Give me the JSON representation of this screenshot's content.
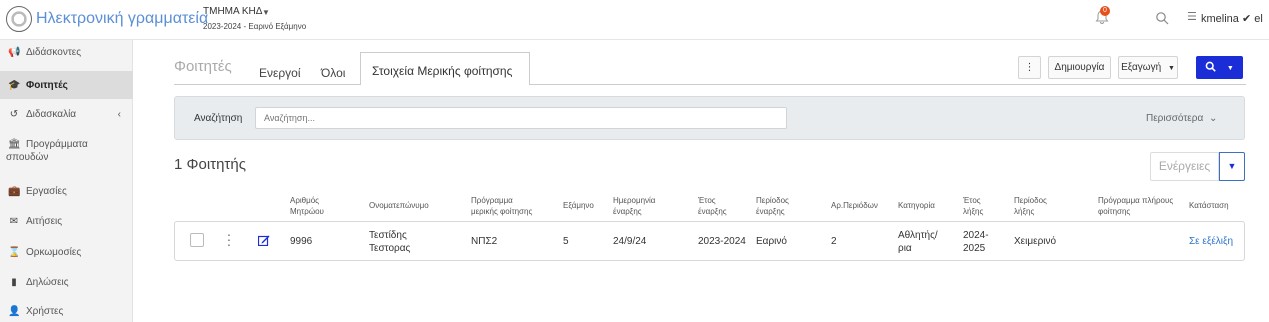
{
  "header": {
    "app_title": "Ηλεκτρονική γραμματεία",
    "department": "ΤΜΗΜΑ ΚΗΔ",
    "period": "2023-2024 - Εαρινό Εξάμηνο",
    "notification_count": "0",
    "user": "kmelina ✔ el"
  },
  "sidebar": {
    "items": [
      {
        "label": "Διδάσκοντες",
        "icon": "megaphone-icon"
      },
      {
        "label": "Φοιτητές",
        "icon": "graduation-cap-icon"
      },
      {
        "label": "Διδασκαλία",
        "icon": "undo-icon"
      },
      {
        "label": "Προγράμματα σπουδών",
        "icon": "institution-icon"
      },
      {
        "label": "Εργασίες",
        "icon": "briefcase-icon"
      },
      {
        "label": "Αιτήσεις",
        "icon": "envelope-icon"
      },
      {
        "label": "Ορκωμοσίες",
        "icon": "hourglass-icon"
      },
      {
        "label": "Δηλώσεις",
        "icon": "file-icon"
      },
      {
        "label": "Χρήστες",
        "icon": "user-icon"
      }
    ],
    "line1": "Προγράμματα",
    "line2": "σπουδών"
  },
  "main": {
    "title": "Φοιτητές",
    "tabs": [
      "Ενεργοί",
      "Όλοι",
      "Στοιχεία Μερικής φοίτησης"
    ],
    "buttons": {
      "create": "Δημιουργία",
      "export": "Εξαγωγή"
    },
    "search_label": "Αναζήτηση",
    "search_placeholder": "Αναζήτηση...",
    "more": "Περισσότερα",
    "count_title": "1 Φοιτητής",
    "actions": "Ενέργειες"
  },
  "table": {
    "headers": [
      "Αριθμός Μητρώου",
      "Ονοματεπώνυμο",
      "Πρόγραμμα μερικής φοίτησης",
      "Εξάμηνο",
      "Ημερομηνία έναρξης",
      "Έτος έναρξης",
      "Περίοδος έναρξης",
      "Αρ.Περιόδων",
      "Κατηγορία",
      "Έτος λήξης",
      "Περίοδος λήξης",
      "Πρόγραμμα πλήρους φοίτησης",
      "Κατάσταση"
    ],
    "row": {
      "reg_no": "9996",
      "name": "Τεστίδης Τεστορας",
      "program": "ΝΠΣ2",
      "semester": "5",
      "start_date": "24/9/24",
      "start_year": "2023-2024",
      "start_period": "Εαρινό",
      "periods": "2",
      "category": "Αθλητής/ρια",
      "end_year": "2024-2025",
      "end_period": "Χειμερινό",
      "full_program": "",
      "status": "Σε εξέλιξη"
    }
  },
  "colors": {
    "primary": "#1a2dd6",
    "link": "#2a73c9",
    "badge": "#e8501b"
  }
}
